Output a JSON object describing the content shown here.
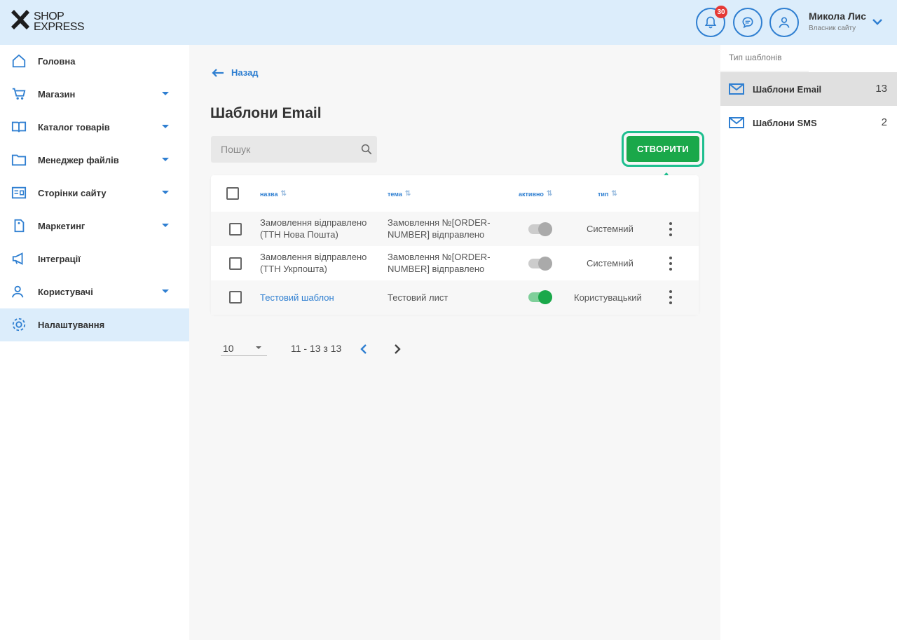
{
  "header": {
    "logo_line1": "SHOP",
    "logo_line2": "EXPRESS",
    "notification_count": "30",
    "user_name": "Микола Лис",
    "user_role": "Власник сайту"
  },
  "sidebar": {
    "items": [
      {
        "label": "Головна"
      },
      {
        "label": "Магазин"
      },
      {
        "label": "Каталог товарів"
      },
      {
        "label": "Менеджер файлів"
      },
      {
        "label": "Сторінки сайту"
      },
      {
        "label": "Маркетинг"
      },
      {
        "label": "Інтеграції"
      },
      {
        "label": "Користувачі"
      },
      {
        "label": "Налаштування"
      }
    ]
  },
  "main": {
    "back_label": "Назад",
    "title": "Шаблони Email",
    "search_placeholder": "Пошук",
    "create_label": "СТВОРИТИ",
    "columns": {
      "name": "назва",
      "subject": "тема",
      "active": "активно",
      "type": "тип"
    },
    "rows": [
      {
        "name_1": "Замовлення відправлено",
        "name_2": "(ТТН Нова Пошта)",
        "subject_1": "Замовлення №[ORDER-",
        "subject_2": "NUMBER] відправлено",
        "active": false,
        "type": "Системний"
      },
      {
        "name_1": "Замовлення відправлено",
        "name_2": "(ТТН Укрпошта)",
        "subject_1": "Замовлення №[ORDER-",
        "subject_2": "NUMBER] відправлено",
        "active": false,
        "type": "Системний"
      },
      {
        "name_1": "Тестовий шаблон",
        "name_2": "",
        "subject_1": "Тестовий лист",
        "subject_2": "",
        "active": true,
        "type": "Користувацький"
      }
    ],
    "pager": {
      "page_size": "10",
      "info": "11 - 13 з 13"
    }
  },
  "right_panel": {
    "tab_label": "Тип шаблонів",
    "items": [
      {
        "label": "Шаблони Email",
        "count": "13"
      },
      {
        "label": "Шаблони SMS",
        "count": "2"
      }
    ]
  },
  "colors": {
    "accent": "#2f7fd1",
    "header_bg": "#dcedfb",
    "create_button": "#1aa84a",
    "highlight_ring": "#1fbf8f",
    "badge": "#e53935"
  }
}
